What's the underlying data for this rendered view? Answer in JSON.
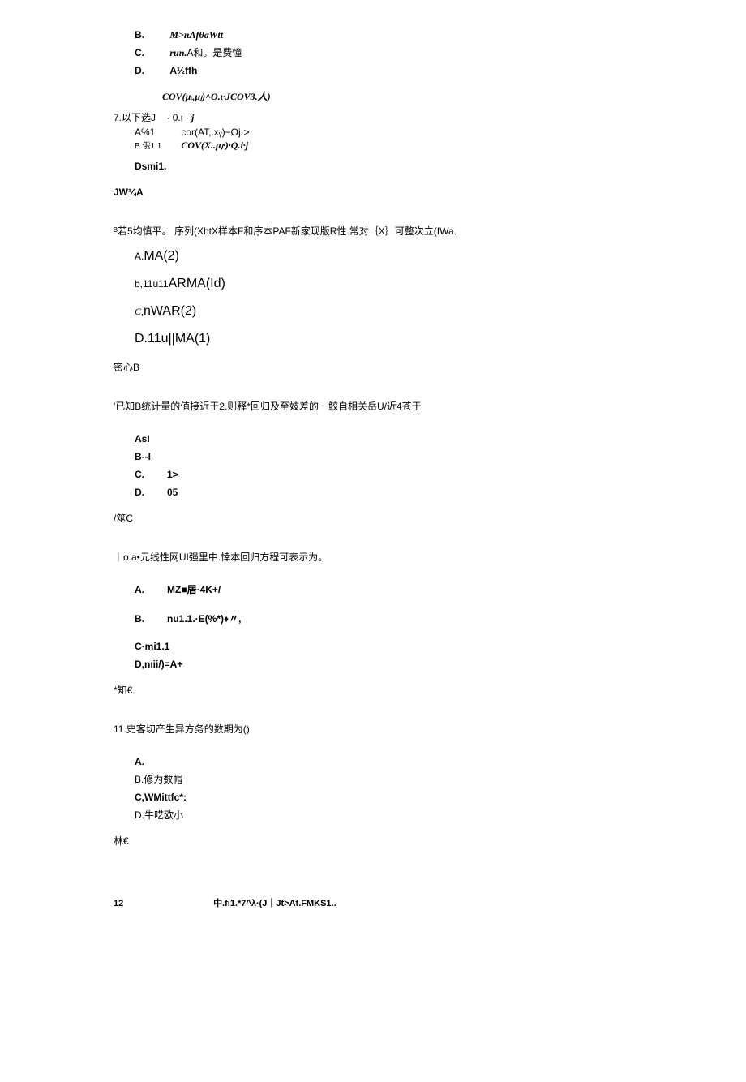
{
  "q6": {
    "opts": {
      "b_label": "B.",
      "b_text": "M>ıιAfθaWtt",
      "c_label": "C.",
      "c_text_prefix": "run.",
      "c_text_rest": "A和。是费憧",
      "d_label": "D.",
      "d_text": "A½ffh"
    }
  },
  "formula": "COV(μᵢ,μⱼ)^O.ι·JCOV3.人)",
  "q7": {
    "prompt_prefix": "7.以下选J",
    "prompt_mid": "· 0.ι · ",
    "prompt_tail": "j",
    "line1_left": "A%1",
    "line1_right": "cor(AT,.xᵧ)−Oj·>",
    "line2_left": "B.俄1.1",
    "line2_right": "COV(X..μⱼ·)·Q.i·j",
    "line3": "Dsmi1.",
    "ans": "JW¼A"
  },
  "q8": {
    "prompt": "ᴮ若5均慎平。 序列(XhtX样本F和序本PAF新家现版R性.常对｛X｝可整次立(IWa.",
    "a_pre": "A.",
    "a_main": "MA(2)",
    "b_pre": "b,11u11",
    "b_main": "ARMA(Id)",
    "c_pre": "C,",
    "c_main": "nWAR(2)",
    "d_pre": "D.11u",
    "d_main": "||MA(1)",
    "ans": "密心B"
  },
  "q9": {
    "prompt": "'已知B统计量的值接近于2.则释*回归及至妓差的一鮫自相关岳U/近4苍于",
    "a": "AsI",
    "b": "B--I",
    "c_label": "C.",
    "c_val": "1>",
    "d_label": "D.",
    "d_val": "05",
    "ans": "/筮C"
  },
  "q10": {
    "prompt": "｜o.a•元线性网UI强里中.悻本回归方程可表示为。",
    "a_label": "A.",
    "a_text": "MZ■居·4K+/",
    "b_label": "B.",
    "b_text": "nu1.1.·E(%*)♦〃,",
    "c": "C·mi1.1",
    "d": "D,nıii/)=A+",
    "ans": "*知€"
  },
  "q11": {
    "prompt": "11.史客切产生异方务的数期为()",
    "a": "A.",
    "b": "B.修为数帽",
    "c": "C,WMittfc*:",
    "d": "D.牛呓欧小",
    "ans": "林€"
  },
  "footer": {
    "page": "12",
    "text": "中.fi1.*7^λ·(J｜Jt>At.FMKS1.."
  }
}
